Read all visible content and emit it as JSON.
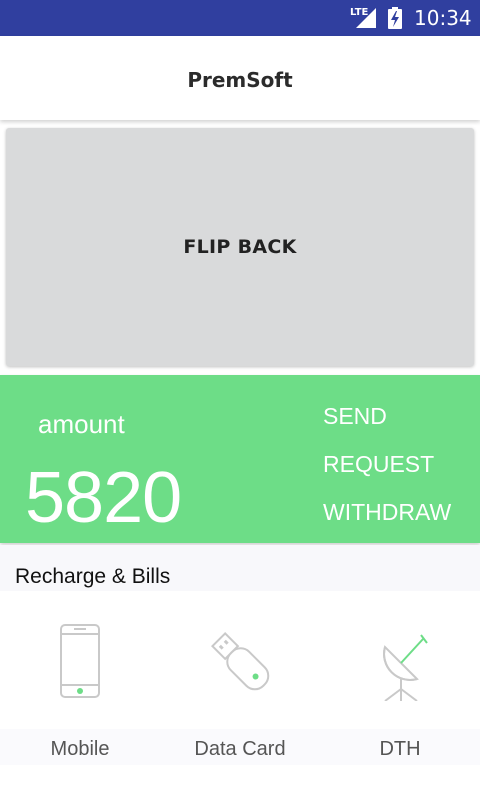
{
  "status_bar": {
    "network": "LTE",
    "time": "10:34"
  },
  "app_bar": {
    "title": "PremSoft"
  },
  "flip_card": {
    "label": "FLIP BACK"
  },
  "balance": {
    "label": "amount",
    "value": "5820",
    "actions": [
      "SEND",
      "REQUEST",
      "WITHDRAW"
    ]
  },
  "recharge": {
    "title": "Recharge & Bills",
    "items": [
      {
        "label": "Mobile",
        "icon": "mobile-phone-icon"
      },
      {
        "label": "Data Card",
        "icon": "usb-dongle-icon"
      },
      {
        "label": "DTH",
        "icon": "satellite-dish-icon"
      }
    ]
  },
  "colors": {
    "status_bar": "#303f9f",
    "balance_panel": "#6ddd87",
    "flip_card": "#d9dadb",
    "icon_accent": "#6ddd87"
  }
}
